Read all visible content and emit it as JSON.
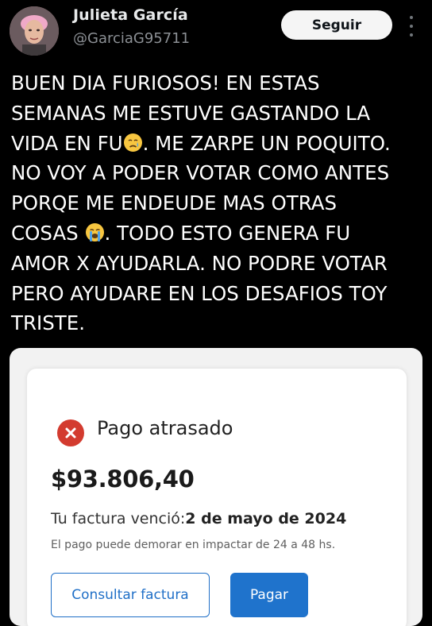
{
  "tweet": {
    "author": {
      "name": "Julieta García",
      "handle": "@GarciaG95711",
      "avatar_icon": "profile-photo"
    },
    "follow_label": "Seguir",
    "more_icon": "more-options-icon",
    "text_lines": [
      "BUEN DIA FURIOSOS! EN ESTAS",
      "SEMANAS ME ESTUVE GASTANDO LA",
      "VIDA EN FU",
      ". ME ZARPE UN POQUITO.",
      "NO VOY A PODER VOTAR COMO ANTES",
      "PORQE ME ENDEUDE MAS OTRAS",
      "COSAS",
      ". TODO ESTO GENERA FU",
      "AMOR X AYUDARLA. NO PODRE VOTAR",
      "PERO AYUDARE EN LOS DESAFIOS TOY",
      "TRISTE."
    ],
    "emojis": [
      "crying-face",
      "loudly-crying-face"
    ]
  },
  "payment_card": {
    "status_icon": "error-x-icon",
    "status": "Pago atrasado",
    "amount": "$93.806,40",
    "due_label": "Tu factura venció:",
    "due_date": "2 de mayo de 2024",
    "note": "El pago puede demorar en impactar de 24 a 48 hs.",
    "consult_label": "Consultar factura",
    "pay_label": "Pagar"
  },
  "colors": {
    "background": "#000000",
    "status_red": "#d33b2f",
    "primary_blue": "#1f73cc"
  }
}
